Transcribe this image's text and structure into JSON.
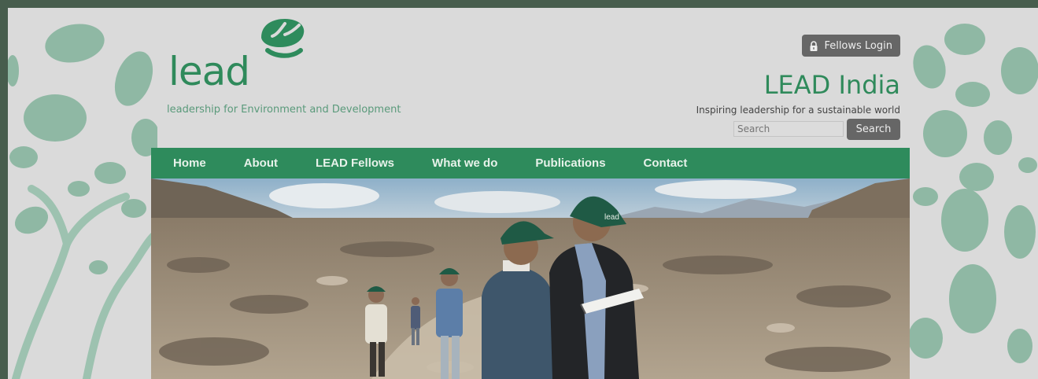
{
  "logo": {
    "word": "lead",
    "tagline": "leadership for Environment and Development"
  },
  "header": {
    "login_label": "Fellows Login",
    "site_title": "LEAD India",
    "site_tagline": "Inspiring leadership for a sustainable world"
  },
  "search": {
    "placeholder": "Search",
    "button_label": "Search"
  },
  "nav": {
    "items": [
      "Home",
      "About",
      "LEAD Fellows",
      "What we do",
      "Publications",
      "Contact"
    ]
  },
  "hero": {
    "cap_text": "lead"
  },
  "colors": {
    "brand_green": "#2e8b5c",
    "page_bg": "#dadada",
    "outer_bg": "#475d4d",
    "button_grey": "#666666"
  },
  "icons": {
    "login": "lock-icon",
    "logo": "leaf-icon"
  }
}
